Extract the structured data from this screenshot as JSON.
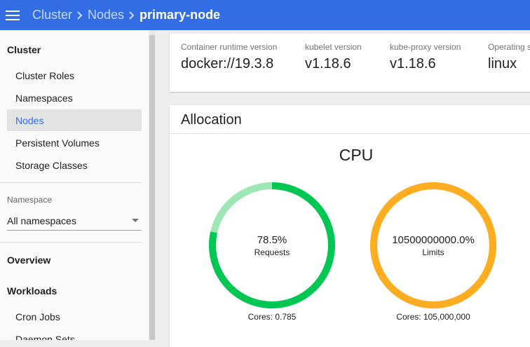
{
  "header": {
    "breadcrumbs": [
      "Cluster",
      "Nodes"
    ],
    "current": "primary-node"
  },
  "sidebar": {
    "section_cluster": "Cluster",
    "cluster_items": [
      "Cluster Roles",
      "Namespaces",
      "Nodes",
      "Persistent Volumes",
      "Storage Classes"
    ],
    "active_item": "Nodes",
    "namespace_label": "Namespace",
    "namespace_value": "All namespaces",
    "overview": "Overview",
    "workloads": "Workloads",
    "workload_items": [
      "Cron Jobs",
      "Daemon Sets"
    ]
  },
  "info": {
    "columns": [
      {
        "label": "Container runtime version",
        "value": "docker://19.3.8"
      },
      {
        "label": "kubelet version",
        "value": "v1.18.6"
      },
      {
        "label": "kube-proxy version",
        "value": "v1.18.6"
      },
      {
        "label": "Operating system",
        "value": "linux"
      }
    ]
  },
  "allocation": {
    "title": "Allocation",
    "chart_heading": "CPU",
    "requests": {
      "value": "78.5%",
      "label": "Requests",
      "caption": "Cores: 0.785",
      "fraction": 0.785
    },
    "limits": {
      "value": "10500000000.0%",
      "label": "Limits",
      "caption": "Cores: 105,000,000",
      "fraction": 1.0
    }
  },
  "colors": {
    "brand": "#326de6",
    "requests_fill": "#00c752",
    "requests_track": "#9ee6b6",
    "limits_fill": "#ffad20"
  }
}
